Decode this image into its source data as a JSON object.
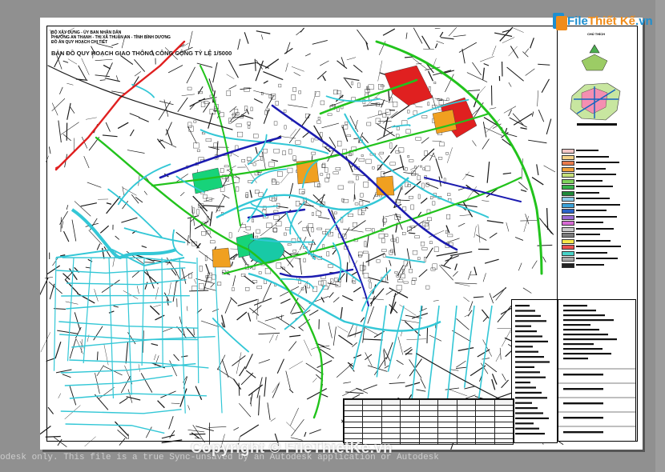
{
  "window": {
    "status_text": "odesk only. This file is a true Sync-unsaved by an Autodesk application or Autodesk"
  },
  "watermark": {
    "logo_part1": "File",
    "logo_part2": "Thiết Kế",
    "logo_part3": ".vn",
    "copyright": "Copyright © FileThietKe.vn"
  },
  "title_block": {
    "line1": "BỘ XÂY DỰNG - ỦY BAN NHÂN DÂN",
    "line2": "PHƯỜNG AN THẠNH - THỊ XÃ THUẬN AN - TỈNH BÌNH DƯƠNG",
    "line3": "ĐỒ ÁN QUY HOẠCH CHI TIẾT",
    "main_title": "BẢN ĐỒ QUY HOẠCH GIAO THÔNG CÔNG CỘNG TỶ LỆ 1/5000"
  },
  "colors": {
    "road_dark": "#1a1a1a",
    "canal": "#33c7d6",
    "green_route": "#22c31c",
    "blue_route": "#1b1bb0",
    "red_route": "#e02020",
    "orange_zone": "#f0a020",
    "park": "#17d37a"
  },
  "legend": {
    "header": "CHÚ THÍCH",
    "swatch_colors": [
      "#f2c6c6",
      "#f4d38a",
      "#e97b4b",
      "#f2a23a",
      "#c6e07a",
      "#7fd35d",
      "#35b34a",
      "#1f8a3a",
      "#8ecbe8",
      "#3ba3d9",
      "#2a63c9",
      "#9b6ad4",
      "#d76ad4",
      "#c8c8c8",
      "#7c7c7c",
      "#f7e84a",
      "#e94f4f",
      "#49d3c8",
      "#aaaaaa",
      "#222222"
    ]
  }
}
